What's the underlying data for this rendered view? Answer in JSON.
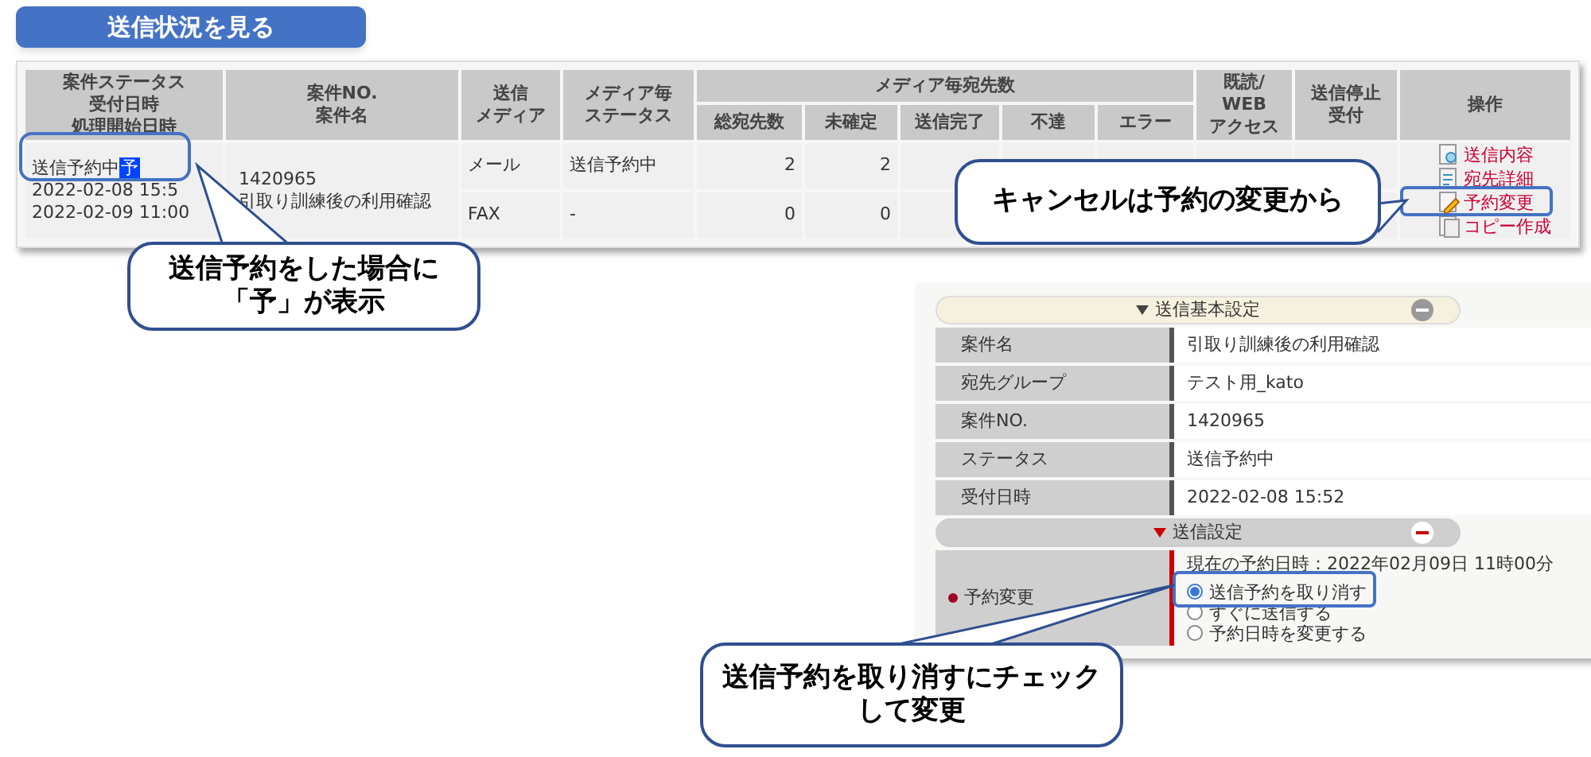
{
  "page_title": "送信状況を見る",
  "table": {
    "columns": [
      [
        "案件ステータス",
        "受付日時",
        "処理開始日時"
      ],
      [
        "案件NO.",
        "案件名"
      ],
      [
        "送信",
        "メディア"
      ],
      [
        "メディア毎",
        "ステータス"
      ]
    ],
    "group": {
      "label": "メディア毎宛先数",
      "columns": [
        "総宛先数",
        "未確定",
        "送信完了",
        "不達",
        "エラー"
      ]
    },
    "columns_after": [
      [
        "既読/",
        "WEB",
        "アクセス"
      ],
      [
        "送信停止",
        "受付"
      ],
      [
        "操作"
      ]
    ],
    "rows": [
      {
        "status": "送信予約中",
        "reserved_badge": "予",
        "received": "2022-02-08 15:5",
        "started": "2022-02-09 11:00",
        "case_no": "1420965",
        "case_name": "引取り訓練後の利用確認",
        "media": [
          {
            "name": "メール",
            "status": "送信予約中",
            "total": "2",
            "unconfirmed": "2"
          },
          {
            "name": "FAX",
            "status": "-",
            "total": "0",
            "unconfirmed": "0"
          }
        ],
        "actions": [
          {
            "kind": "view",
            "label": "送信内容"
          },
          {
            "kind": "detail",
            "label": "宛先詳細"
          },
          {
            "kind": "edit",
            "label": "予約変更"
          },
          {
            "kind": "copy",
            "label": "コピー作成"
          }
        ]
      }
    ]
  },
  "panel": {
    "sections": [
      {
        "title": "送信基本設定",
        "expanded": true,
        "highlighted": false,
        "rows": [
          {
            "label": "案件名",
            "value": "引取り訓練後の利用確認"
          },
          {
            "label": "宛先グループ",
            "value": "テスト用_kato"
          },
          {
            "label": "案件NO.",
            "value": "1420965"
          },
          {
            "label": "ステータス",
            "value": "送信予約中"
          },
          {
            "label": "受付日時",
            "value": "2022-02-08 15:52"
          }
        ]
      },
      {
        "title": "送信設定",
        "expanded": true,
        "highlighted": true,
        "reservation": {
          "label": "予約変更",
          "required": true,
          "current": "現在の予約日時：2022年02月09日 11時00分",
          "options": [
            {
              "label": "送信予約を取り消す",
              "selected": true
            },
            {
              "label": "すぐに送信する",
              "selected": false
            },
            {
              "label": "予約日時を変更する",
              "selected": false
            }
          ]
        }
      }
    ]
  },
  "callouts": [
    {
      "lines": [
        "送信予約をした場合に",
        "「予」が表示"
      ]
    },
    {
      "lines": [
        "キャンセルは予約の変更から"
      ]
    },
    {
      "lines": [
        "送信予約を取り消すにチェック",
        "して変更"
      ]
    }
  ]
}
